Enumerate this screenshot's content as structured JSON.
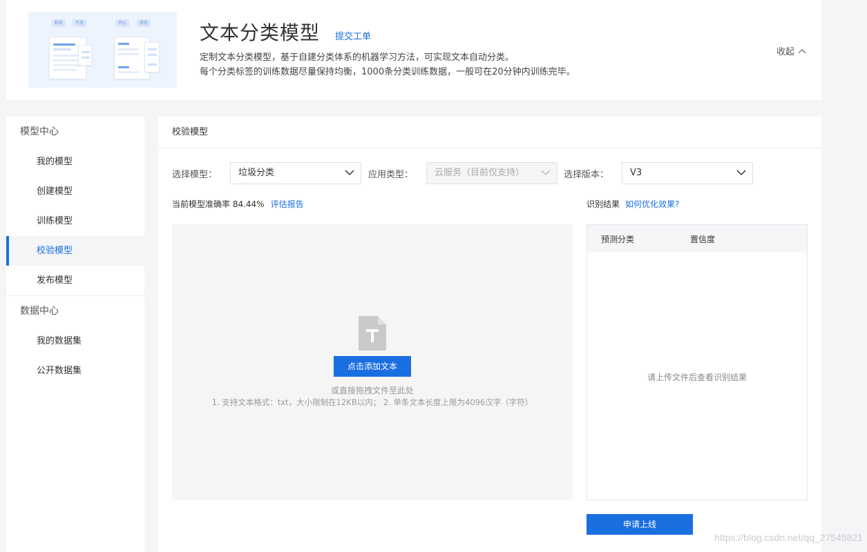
{
  "banner": {
    "illustration": {
      "tags": [
        "科技",
        "汽车",
        "开心",
        "悲伤"
      ]
    },
    "title": "文本分类模型",
    "ticket_link": "提交工单",
    "desc_line1": "定制文本分类模型，基于自建分类体系的机器学习方法，可实现文本自动分类。",
    "desc_line2": "每个分类标签的训练数据尽量保持均衡，1000条分类训练数据，一般可在20分钟内训练完毕。",
    "collapse_label": "收起",
    "collapse_icon": "chevron-up-icon"
  },
  "sidebar": {
    "groups": [
      {
        "label": "模型中心",
        "items": [
          {
            "label": "我的模型",
            "active": false
          },
          {
            "label": "创建模型",
            "active": false
          },
          {
            "label": "训练模型",
            "active": false
          },
          {
            "label": "校验模型",
            "active": true
          },
          {
            "label": "发布模型",
            "active": false
          }
        ]
      },
      {
        "label": "数据中心",
        "items": [
          {
            "label": "我的数据集",
            "active": false
          },
          {
            "label": "公开数据集",
            "active": false
          }
        ]
      }
    ]
  },
  "content": {
    "header": "校验模型",
    "filters": {
      "model_label": "选择模型：",
      "model_value": "垃圾分类",
      "app_label": "应用类型：",
      "app_value": "云服务（目前仅支持）",
      "version_label": "选择版本：",
      "version_value": "V3"
    },
    "accuracy_text": "当前模型准确率 84.44%",
    "report_link": "评估报告",
    "result_label": "识别结果",
    "optimize_link": "如何优化效果?",
    "dropzone": {
      "file_icon": "text-file-icon",
      "add_button": "点击添加文本",
      "drag_hint": "或直接拖拽文件至此处",
      "format_hint": "1. 支持文本格式：txt，大小限制在12KB以内；  2. 单条文本长度上限为4096汉字（字符）"
    },
    "result_table": {
      "col_category": "预测分类",
      "col_confidence": "置信度",
      "empty_text": "请上传文件后查看识别结果"
    },
    "submit_button": "申请上线"
  },
  "watermark": "https://blog.csdn.net/qq_27545821",
  "colors": {
    "accent": "#1a6fe0",
    "background": "#f4f5f7"
  }
}
